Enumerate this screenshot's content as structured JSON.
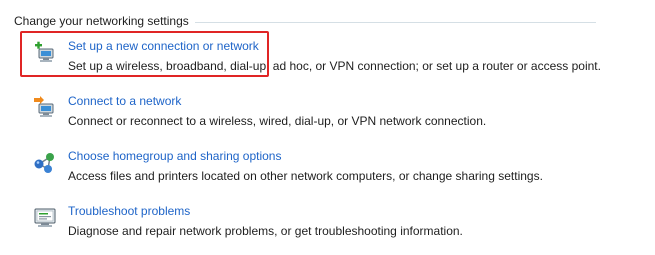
{
  "section": {
    "title": "Change your networking settings"
  },
  "tasks": [
    {
      "link": "Set up a new connection or network",
      "description": "Set up a wireless, broadband, dial-up, ad hoc, or VPN connection; or set up a router or access point.",
      "icon": "new-connection-icon"
    },
    {
      "link": "Connect to a network",
      "description": "Connect or reconnect to a wireless, wired, dial-up, or VPN network connection.",
      "icon": "connect-network-icon"
    },
    {
      "link": "Choose homegroup and sharing options",
      "description": "Access files and printers located on other network computers, or change sharing settings.",
      "icon": "homegroup-icon"
    },
    {
      "link": "Troubleshoot problems",
      "description": "Diagnose and repair network problems, or get troubleshooting information.",
      "icon": "troubleshoot-icon"
    }
  ],
  "colors": {
    "link": "#1e64c8",
    "text": "#1e1e1e",
    "highlight": "#e02525",
    "rule": "#d5dfe5"
  }
}
